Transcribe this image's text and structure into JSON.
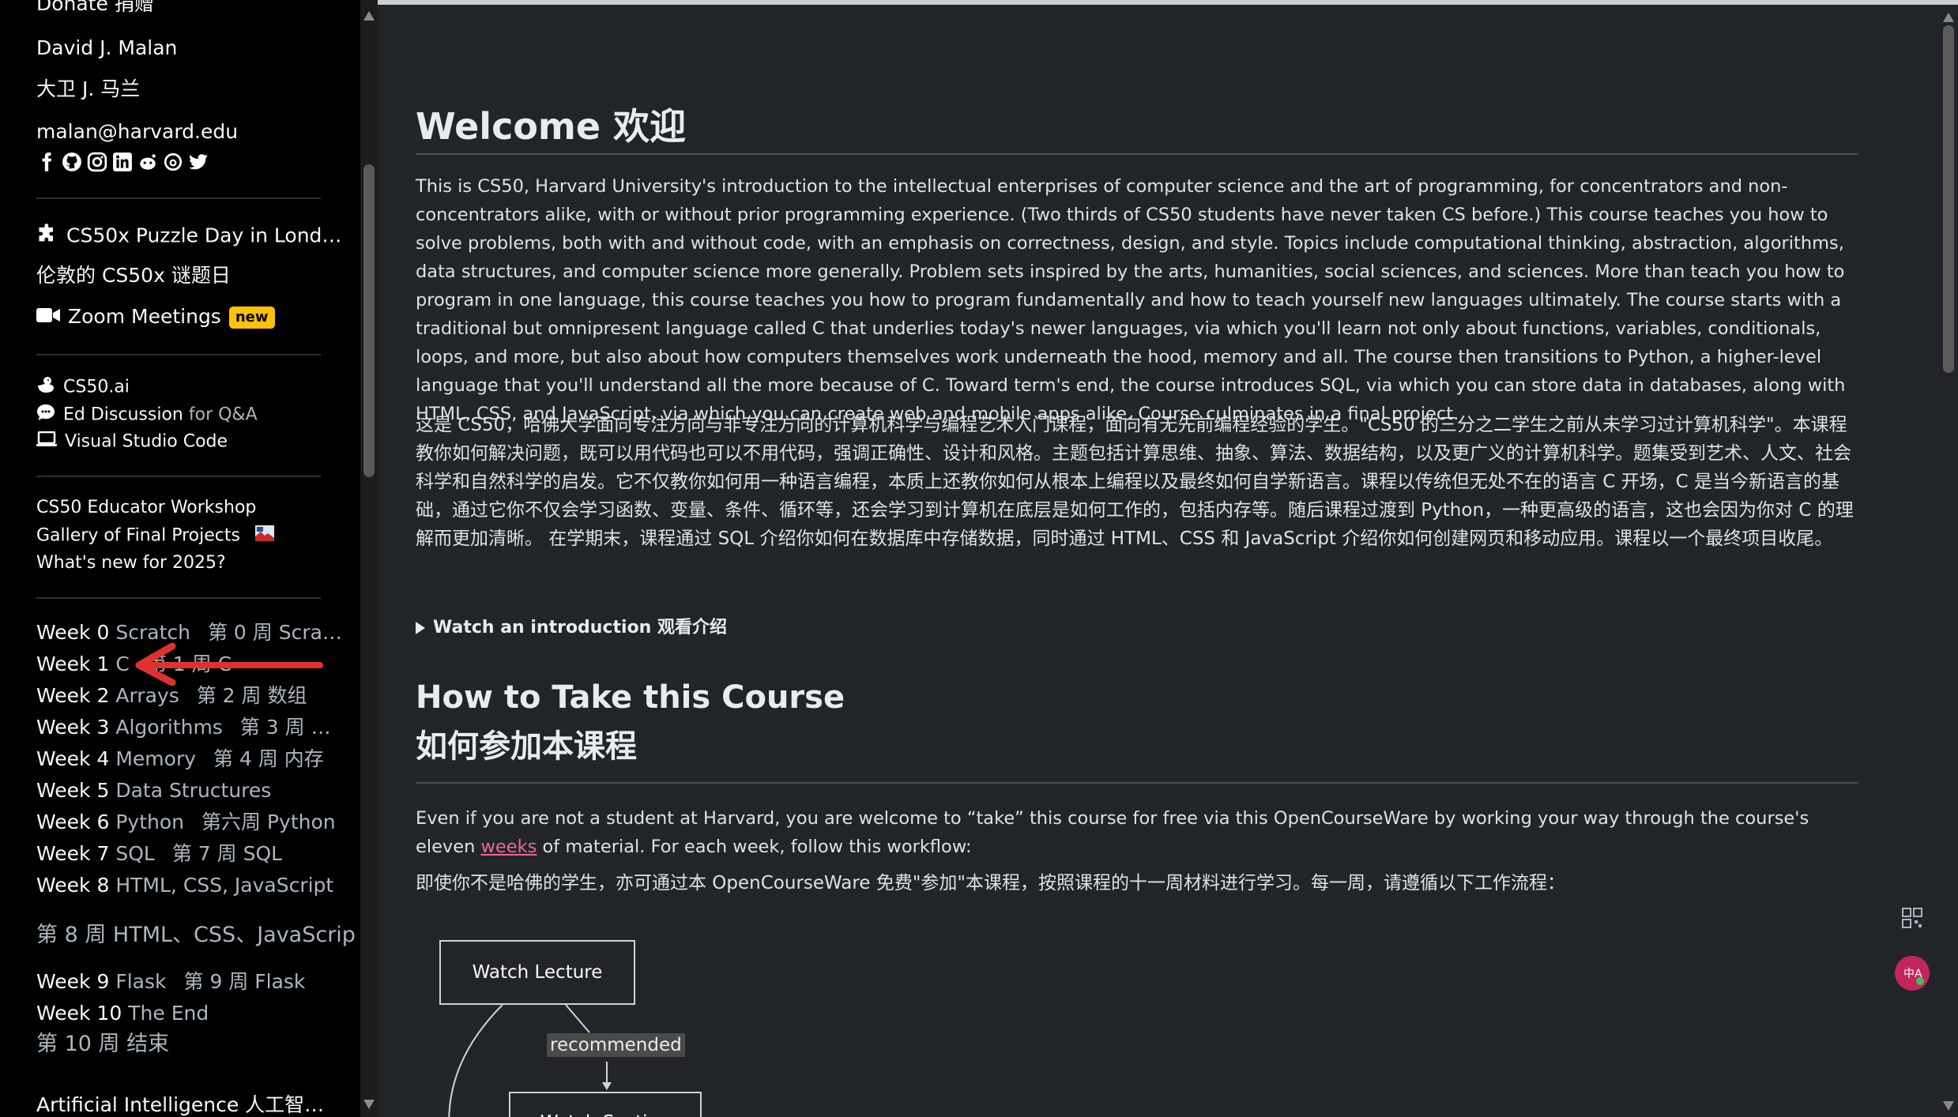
{
  "sidebar": {
    "donate": "Donate 捐赠",
    "author_name": "David J. Malan",
    "author_name_zh": "大卫 J. 马兰",
    "email": "malan@harvard.edu",
    "social_icons": [
      "facebook-icon",
      "github-icon",
      "instagram-icon",
      "linkedin-icon",
      "reddit-icon",
      "threads-icon",
      "twitter-icon"
    ],
    "puzzle": "CS50x Puzzle Day in Lond…",
    "puzzle_zh": "伦敦的 CS50x 谜题日",
    "zoom": "Zoom Meetings",
    "zoom_badge": "new",
    "cs50ai": "CS50.ai",
    "ed": "Ed Discussion",
    "ed_suffix": "for Q&A",
    "vscode": "Visual Studio Code",
    "workshop": "CS50 Educator Workshop",
    "gallery": "Gallery of Final Projects",
    "whatsnew": "What's new for 2025?",
    "weeks": [
      {
        "week": "Week 0",
        "topic": "Scratch",
        "zh": "第 0 周 Scra…"
      },
      {
        "week": "Week 1",
        "topic": "C",
        "zh": "第 1 周 C"
      },
      {
        "week": "Week 2",
        "topic": "Arrays",
        "zh": "第 2 周 数组"
      },
      {
        "week": "Week 3",
        "topic": "Algorithms",
        "zh": "第 3 周 …"
      },
      {
        "week": "Week 4",
        "topic": "Memory",
        "zh": "第 4 周 内存"
      },
      {
        "week": "Week 5",
        "topic": "Data Structures",
        "zh": ""
      },
      {
        "week": "Week 6",
        "topic": "Python",
        "zh": "第六周 Python"
      },
      {
        "week": "Week 7",
        "topic": "SQL",
        "zh": "第 7 周 SQL"
      },
      {
        "week": "Week 8",
        "topic": "HTML, CSS, JavaScript",
        "zh": ""
      },
      {
        "week": "Week 9",
        "topic": "Flask",
        "zh": "第 9 周 Flask"
      },
      {
        "week": "Week 10",
        "topic": "The End",
        "zh": ""
      }
    ],
    "week8_zh": "第 8 周 HTML、CSS、JavaScrip",
    "week10_zh": "第 10 周 结束",
    "ai": "Artificial Intelligence 人工智…",
    "accent": "#e03131"
  },
  "main": {
    "welcome_title": "Welcome  欢迎",
    "intro_en": "This is CS50, Harvard University's introduction to the intellectual enterprises of computer science and the art of programming, for concentrators and non-concentrators alike, with or without prior programming experience. (Two thirds of CS50 students have never taken CS before.) This course teaches you how to solve problems, both with and without code, with an emphasis on correctness, design, and style. Topics include computational thinking, abstraction, algorithms, data structures, and computer science more generally. Problem sets inspired by the arts, humanities, social sciences, and sciences. More than teach you how to program in one language, this course teaches you how to program fundamentally and how to teach yourself new languages ultimately. The course starts with a traditional but omnipresent language called C that underlies today's newer languages, via which you'll learn not only about functions, variables, conditionals, loops, and more, but also about how computers themselves work underneath the hood, memory and all. The course then transitions to Python, a higher-level language that you'll understand all the more because of C. Toward term's end, the course introduces SQL, via which you can store data in databases, along with HTML, CSS, and JavaScript, via which you can create web and mobile apps alike. Course culminates in a final project.",
    "intro_zh": "这是 CS50，哈佛大学面向专注方向与非专注方向的计算机科学与编程艺术入门课程，面向有无先前编程经验的学生。\"CS50 的三分之二学生之前从未学习过计算机科学\"。本课程教你如何解决问题，既可以用代码也可以不用代码，强调正确性、设计和风格。主题包括计算思维、抽象、算法、数据结构，以及更广义的计算机科学。题集受到艺术、人文、社会科学和自然科学的启发。它不仅教你如何用一种语言编程，本质上还教你如何从根本上编程以及最终如何自学新语言。课程以传统但无处不在的语言 C 开场，C 是当今新语言的基础，通过它你不仅会学习函数、变量、条件、循环等，还会学习到计算机在底层是如何工作的，包括内存等。随后课程过渡到 Python，一种更高级的语言，这也会因为你对 C 的理解而更加清晰。 在学期末，课程通过 SQL 介绍你如何在数据库中存储数据，同时通过 HTML、CSS 和 JavaScript 介绍你如何创建网页和移动应用。课程以一个最终项目收尾。",
    "watch_intro": "Watch an introduction  观看介绍",
    "howto_title": "How to Take this Course",
    "howto_title_zh": "如何参加本课程",
    "howto_en_pre": "Even if you are not a student at Harvard, you are welcome to “take” this course for free via this OpenCourseWare by working your way through the course's eleven",
    "howto_link": "weeks",
    "howto_en_post": "of material. For each week, follow this workflow:",
    "howto_zh": "即使你不是哈佛的学生，亦可通过本 OpenCourseWare 免费\"参加\"本课程，按照课程的十一周材料进行学习。每一周，请遵循以下工作流程：",
    "flow": {
      "box1": "Watch Lecture",
      "edge_label": "recommended",
      "box2": "Watch Section"
    }
  }
}
